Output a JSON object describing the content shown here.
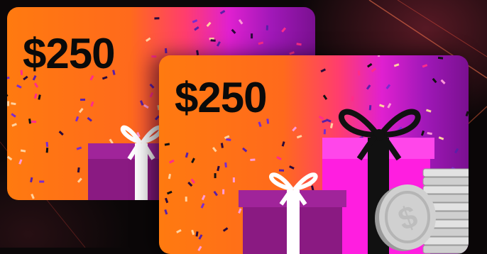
{
  "back_card": {
    "amount": "$250"
  },
  "front_card": {
    "amount": "$250"
  },
  "colors": {
    "card_orange": "#ff7a10",
    "card_magenta": "#e020d0",
    "card_purple": "#7a1090",
    "gift_purple": "#8a1a82",
    "gift_pink": "#ff1ee0",
    "ribbon_white": "#ffffff",
    "ribbon_black": "#111111",
    "coin_silver": "#c8c8c8"
  },
  "icons": [
    "confetti",
    "gift-box-icon",
    "bow-icon",
    "dollar-coin-icon",
    "coin-stack-icon"
  ]
}
